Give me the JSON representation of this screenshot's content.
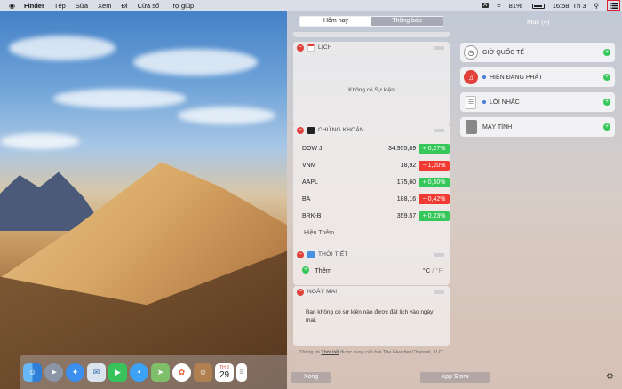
{
  "menubar": {
    "apple": "",
    "items": [
      "Finder",
      "Tệp",
      "Sửa",
      "Xem",
      "Đi",
      "Cửa sổ",
      "Trợ giúp"
    ],
    "input_badge": "A",
    "battery": "81%",
    "clock": "16:58, Th 3"
  },
  "nc": {
    "tabs": {
      "today": "Hôm nay",
      "notifications": "Thông báo"
    },
    "calendar": {
      "title": "LỊCH",
      "empty": "Không có Sự kiện"
    },
    "stocks": {
      "title": "CHỨNG KHOÁN",
      "rows": [
        {
          "symbol": "DOW J",
          "price": "34.955,89",
          "change": "+ 0,27%"
        },
        {
          "symbol": "VNM",
          "price": "18,92",
          "change": "− 1,20%"
        },
        {
          "symbol": "AAPL",
          "price": "175,60",
          "change": "+ 0,50%"
        },
        {
          "symbol": "BA",
          "price": "188,16",
          "change": "− 0,42%"
        },
        {
          "symbol": "BRK-B",
          "price": "359,57",
          "change": "+ 0,23%"
        }
      ],
      "more": "Hiện Thêm..."
    },
    "weather": {
      "title": "THỜI TIẾT",
      "add": "Thêm",
      "unit_c": "°C",
      "sep": "/",
      "unit_f": "°F"
    },
    "tomorrow": {
      "title": "NGÀY MAI",
      "text": "Bạn không có sự kiện nào được đặt lịch vào ngày mai."
    },
    "credit": {
      "prefix": "Thông tin ",
      "link": "Thời tiết",
      "suffix": " được cung cấp bởi The Weather Channel, LLC"
    },
    "right": {
      "title": "Mục (4)",
      "items": [
        "GIỜ QUỐC TẾ",
        "HIỆN ĐANG PHÁT",
        "LỜI NHẮC",
        "MÁY TÍNH"
      ]
    },
    "buttons": {
      "done": "Xong",
      "app_store": "App Store"
    }
  },
  "dock": {
    "apps": [
      "finder",
      "launchpad",
      "safari",
      "mail",
      "facetime",
      "messages",
      "maps",
      "photos",
      "contacts",
      "calendar",
      "reminders"
    ],
    "calendar_month": "TH 3",
    "calendar_day": "29"
  }
}
